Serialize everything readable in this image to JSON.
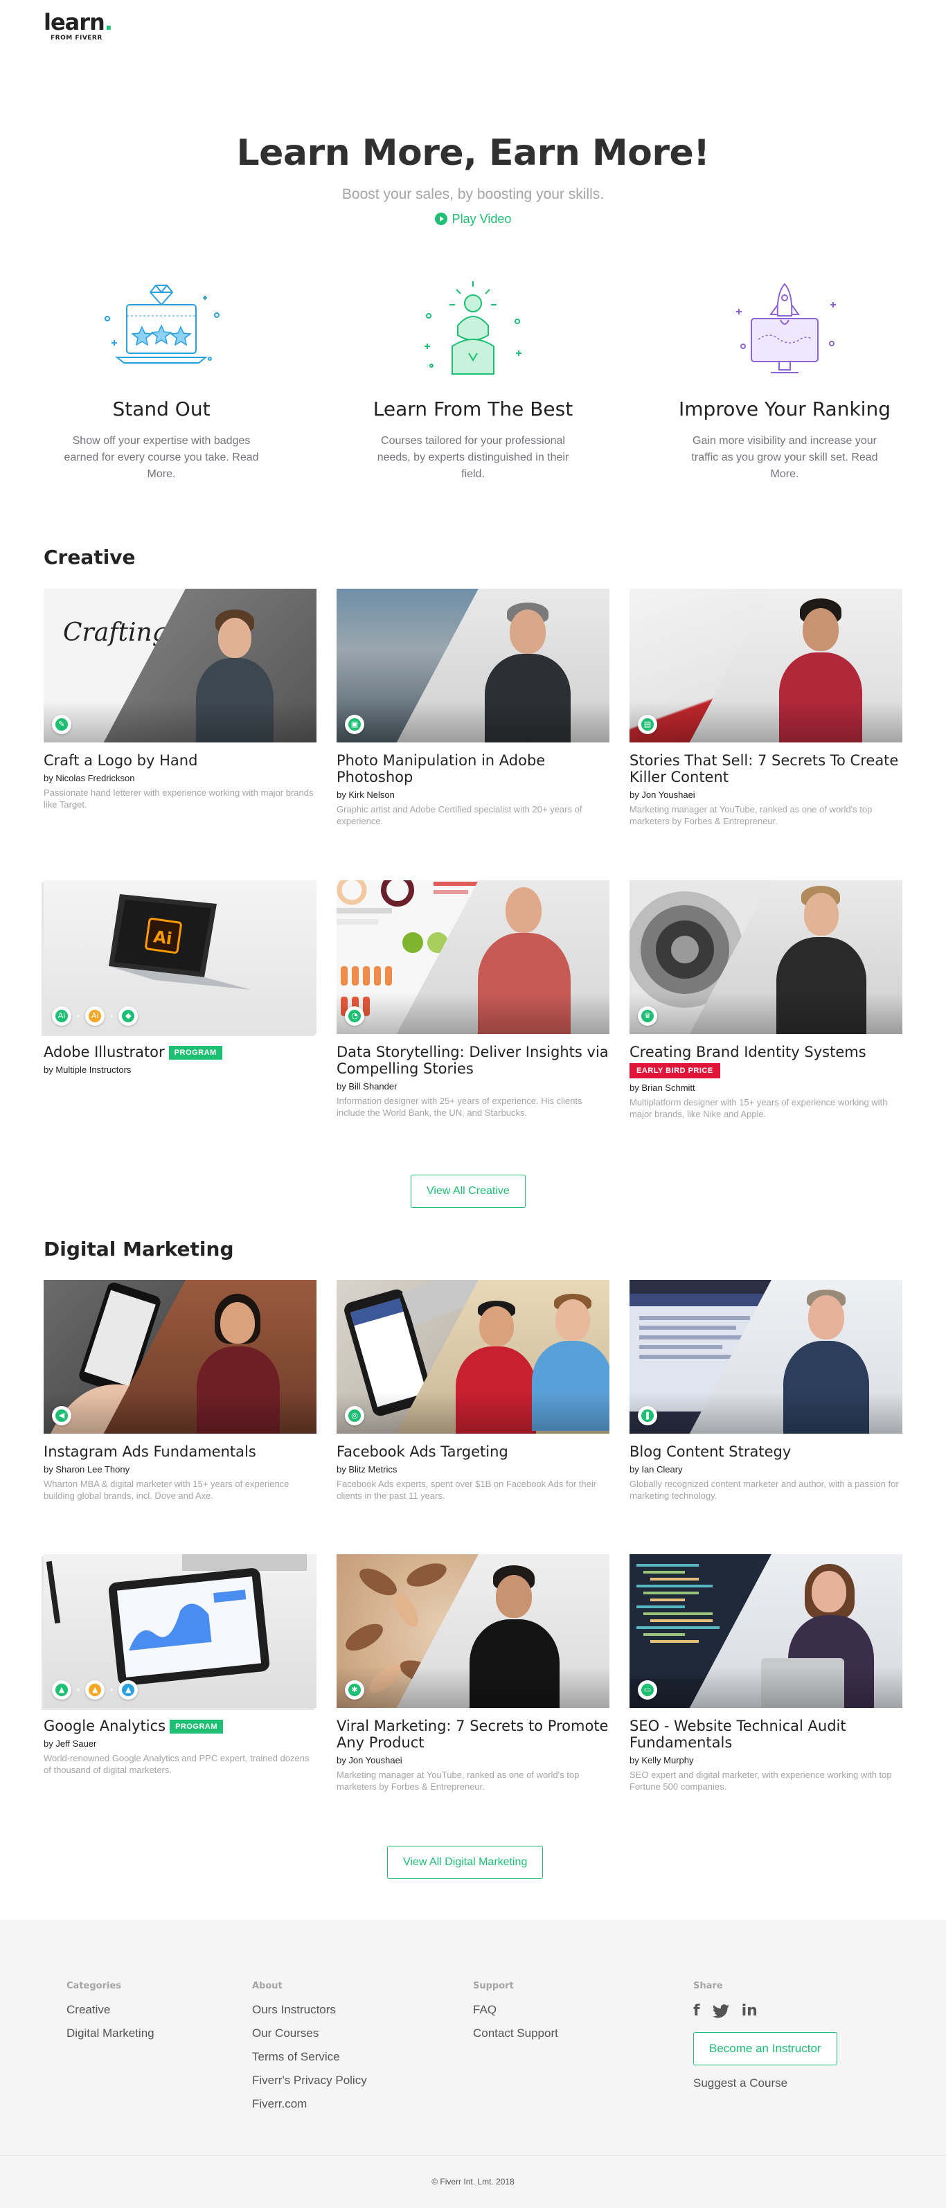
{
  "logo": {
    "main": "learn",
    "dot": ".",
    "sub": "FROM FIVERR"
  },
  "hero": {
    "title": "Learn More, Earn More!",
    "subtitle": "Boost your sales, by boosting your skills.",
    "play_label": "Play Video"
  },
  "features": [
    {
      "title": "Stand Out",
      "desc": "Show off your expertise with badges earned for every course you take. Read More.",
      "icon": "laptop-stars-illustration"
    },
    {
      "title": "Learn From The Best",
      "desc": "Courses tailored for your professional needs, by experts distinguished in their field.",
      "icon": "instructor-illustration"
    },
    {
      "title": "Improve Your Ranking",
      "desc": "Gain more visibility and increase your traffic as you grow your skill set. Read More.",
      "icon": "rocket-illustration"
    }
  ],
  "creative": {
    "title": "Creative",
    "view_all": "View All Creative",
    "courses": [
      {
        "title": "Craft a Logo by Hand",
        "author": "by Nicolas Fredrickson",
        "desc": "Passionate hand letterer with experience working with major brands like Target.",
        "tag": "",
        "icon": "pen-icon",
        "thumb_text": "Crafting a LOGO by Hand"
      },
      {
        "title": "Photo Manipulation in Adobe Photoshop",
        "author": "by Kirk Nelson",
        "desc": "Graphic artist and Adobe Certified specialist with 20+ years of experience.",
        "tag": "",
        "icon": "image-icon"
      },
      {
        "title": "Stories That Sell: 7 Secrets To Create Killer Content",
        "author": "by Jon Youshaei",
        "desc": "Marketing manager at YouTube, ranked as one of world's top marketers by Forbes & Entrepreneur.",
        "tag": "",
        "icon": "book-icon"
      },
      {
        "title": "Adobe Illustrator",
        "author": "by Multiple Instructors",
        "desc": "",
        "tag": "PROGRAM",
        "icon": "illustrator-icon",
        "thumb_text": "Ai"
      },
      {
        "title": "Data Storytelling: Deliver Insights via Compelling Stories",
        "author": "by Bill Shander",
        "desc": "Information designer with 25+ years of experience. His clients include the World Bank, the UN, and Starbucks.",
        "tag": "",
        "icon": "chart-icon"
      },
      {
        "title": "Creating Brand Identity Systems",
        "author": "by Brian Schmitt",
        "desc": "Multiplatform designer with 15+ years of experience working with major brands, like Nike and Apple.",
        "tag": "EARLY BIRD PRICE",
        "icon": "crown-icon"
      }
    ]
  },
  "digital": {
    "title": "Digital Marketing",
    "view_all": "View All Digital Marketing",
    "courses": [
      {
        "title": "Instagram Ads Fundamentals",
        "author": "by Sharon Lee Thony",
        "desc": "Wharton MBA & digital marketer with 15+ years of experience building global brands, incl. Dove and Axe.",
        "tag": "",
        "icon": "megaphone-icon"
      },
      {
        "title": "Facebook Ads Targeting",
        "author": "by Blitz Metrics",
        "desc": "Facebook Ads experts, spent over $1B on Facebook Ads for their clients in the past 11 years.",
        "tag": "",
        "icon": "target-icon"
      },
      {
        "title": "Blog Content Strategy",
        "author": "by Ian Cleary",
        "desc": "Globally recognized content marketer and author, with a passion for marketing technology.",
        "tag": "",
        "icon": "bookmark-icon"
      },
      {
        "title": "Google Analytics",
        "author": "by Jeff Sauer",
        "desc": "World-renowned Google Analytics and PPC expert, trained dozens of thousand of digital marketers.",
        "tag": "PROGRAM",
        "icon": "analytics-icon"
      },
      {
        "title": "Viral Marketing: 7 Secrets to Promote Any Product",
        "author": "by Jon Youshaei",
        "desc": "Marketing manager at YouTube, ranked as one of world's top marketers by Forbes & Entrepreneur.",
        "tag": "",
        "icon": "virus-icon"
      },
      {
        "title": "SEO - Website Technical Audit Fundamentals",
        "author": "by Kelly Murphy",
        "desc": "SEO expert and digital marketer, with experience working with top Fortune 500 companies.",
        "tag": "",
        "icon": "browser-icon"
      }
    ]
  },
  "footer": {
    "categories": {
      "head": "Categories",
      "links": [
        "Creative",
        "Digital Marketing"
      ]
    },
    "about": {
      "head": "About",
      "links": [
        "Ours Instructors",
        "Our Courses",
        "Terms of Service",
        "Fiverr's Privacy Policy",
        "Fiverr.com"
      ]
    },
    "support": {
      "head": "Support",
      "links": [
        "FAQ",
        "Contact Support"
      ]
    },
    "share": {
      "head": "Share",
      "icons": [
        "facebook-icon",
        "twitter-icon",
        "linkedin-icon"
      ],
      "become": "Become an Instructor",
      "suggest": "Suggest a Course"
    },
    "copyright": "© Fiverr Int. Lmt. 2018"
  },
  "colors": {
    "accent": "#1dbf73",
    "early_bird": "#e1153a",
    "muted": "#a5a5a5"
  }
}
